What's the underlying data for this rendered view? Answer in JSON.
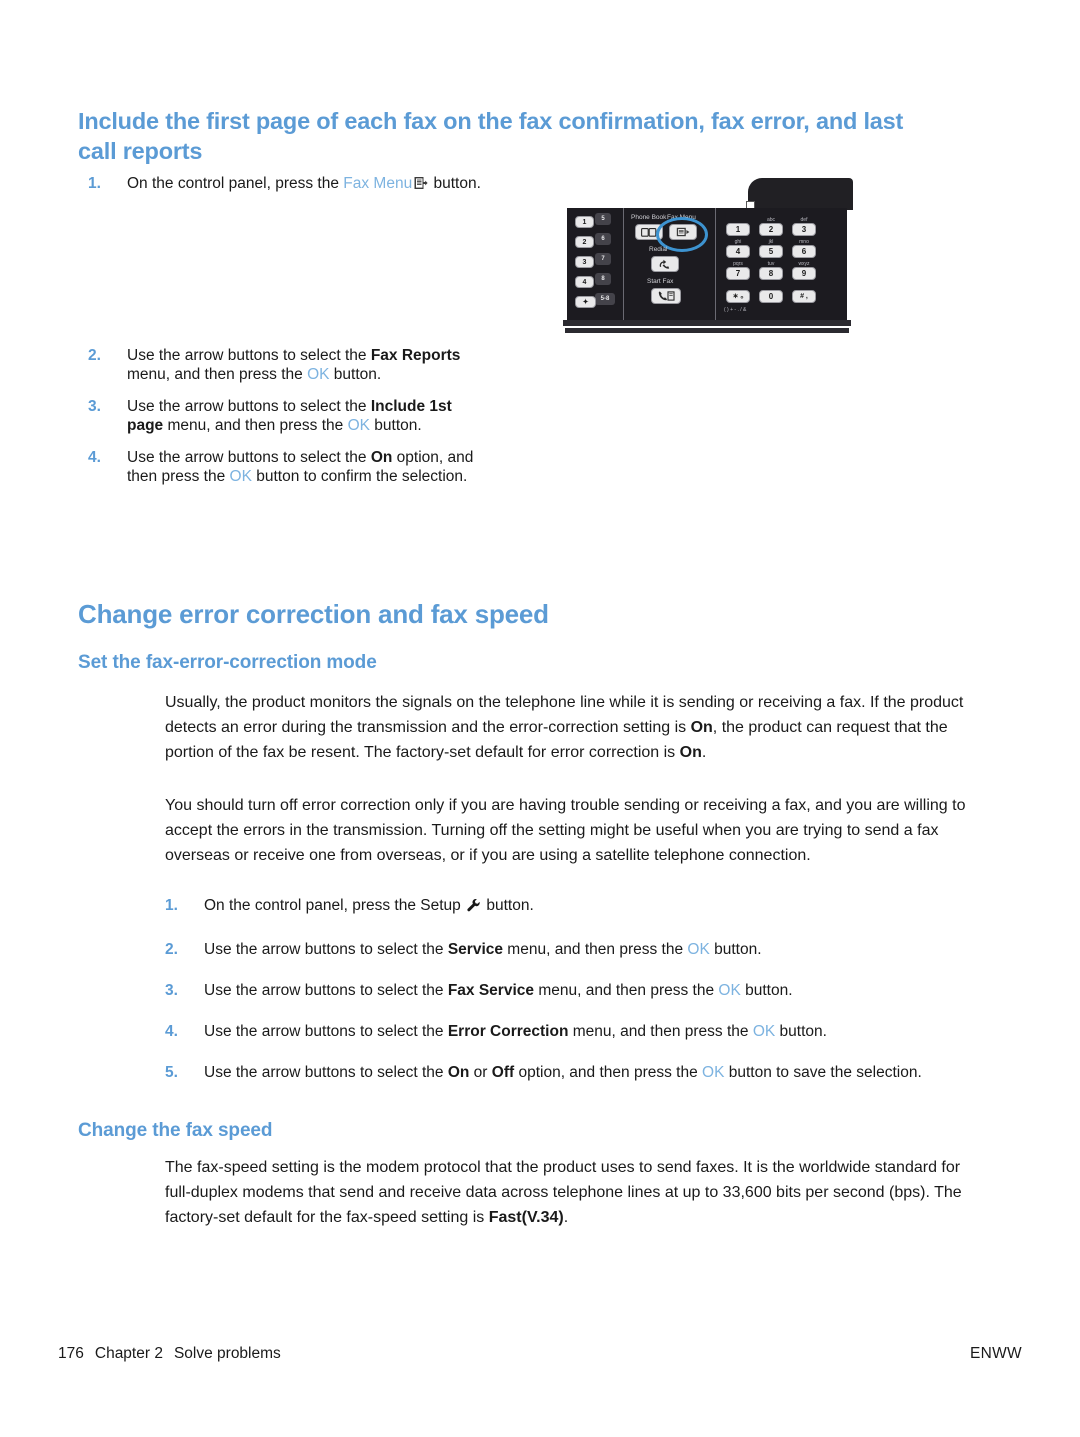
{
  "document": {
    "heading1": "Include the first page of each fax on the fax confirmation, fax error, and last call reports",
    "heading2": "Change error correction and fax speed",
    "heading3_a": "Set the fax-error-correction mode",
    "heading3_b": "Change the fax speed",
    "heading_color": "#5b9bd5"
  },
  "steps_group1": [
    {
      "num": "1.",
      "prefix": "On the control panel, press the ",
      "link": "Fax Menu",
      "icon": "fax-menu-icon",
      "suffix": " button."
    },
    {
      "num": "2.",
      "prefix": "Use the arrow buttons to select the ",
      "bold1": "Fax Reports",
      "mid": " menu, and then press the ",
      "link": "OK",
      "suffix": " button."
    },
    {
      "num": "3.",
      "prefix": "Use the arrow buttons to select the ",
      "bold1": "Include 1st page",
      "mid": " menu, and then press the ",
      "link": "OK",
      "suffix": " button."
    },
    {
      "num": "4.",
      "prefix": "Use the arrow buttons to select the ",
      "bold1": "On",
      "mid": " option, and then press the ",
      "link": "OK",
      "suffix": " button to confirm the selection."
    }
  ],
  "paragraphs": {
    "p1_part1": "Usually, the product monitors the signals on the telephone line while it is sending or receiving a fax. If the product detects an error during the transmission and the error-correction setting is ",
    "p1_bold1": "On",
    "p1_part2": ", the product can request that the portion of the fax be resent. The factory-set default for error correction is ",
    "p1_bold2": "On",
    "p1_part3": ".",
    "p2": "You should turn off error correction only if you are having trouble sending or receiving a fax, and you are willing to accept the errors in the transmission. Turning off the setting might be useful when you are trying to send a fax overseas or receive one from overseas, or if you are using a satellite telephone connection.",
    "p3_part1": "The fax-speed setting is the modem protocol that the product uses to send faxes. It is the worldwide standard for full-duplex modems that send and receive data across telephone lines at up to 33,600 bits per second (bps). The factory-set default for the fax-speed setting is ",
    "p3_bold1": "Fast(V.34)",
    "p3_part2": "."
  },
  "steps_group2": [
    {
      "num": "1.",
      "prefix": "On the control panel, press the Setup ",
      "icon": "wrench-icon",
      "suffix": " button."
    },
    {
      "num": "2.",
      "prefix": "Use the arrow buttons to select the ",
      "bold1": "Service",
      "mid": " menu, and then press the ",
      "link": "OK",
      "suffix": " button."
    },
    {
      "num": "3.",
      "prefix": "Use the arrow buttons to select the ",
      "bold1": "Fax Service",
      "mid": " menu, and then press the ",
      "link": "OK",
      "suffix": " button."
    },
    {
      "num": "4.",
      "prefix": "Use the arrow buttons to select the ",
      "bold1": "Error Correction",
      "mid": " menu, and then press the ",
      "link": "OK",
      "suffix": " button."
    },
    {
      "num": "5.",
      "prefix": "Use the arrow buttons to select the ",
      "bold1": "On",
      "mid1": " or ",
      "bold2": "Off",
      "mid": " option, and then press the ",
      "link": "OK",
      "suffix": " button to save the selection."
    }
  ],
  "control_panel": {
    "labels": {
      "phone_book": "Phone Book",
      "fax_menu": "Fax Menu",
      "redial": "Redial",
      "start_fax": "Start Fax"
    },
    "speed_dial_keys": [
      {
        "main": "1",
        "alt": "5"
      },
      {
        "main": "2",
        "alt": "6"
      },
      {
        "main": "3",
        "alt": "7"
      },
      {
        "main": "4",
        "alt": "8"
      },
      {
        "main": "✦",
        "alt": "5-8"
      }
    ],
    "keypad": [
      {
        "digit": "1",
        "letters": ""
      },
      {
        "digit": "2",
        "letters": "abc"
      },
      {
        "digit": "3",
        "letters": "def"
      },
      {
        "digit": "4",
        "letters": "ghi"
      },
      {
        "digit": "5",
        "letters": "jkl"
      },
      {
        "digit": "6",
        "letters": "mno"
      },
      {
        "digit": "7",
        "letters": "pqrs"
      },
      {
        "digit": "8",
        "letters": "tuv"
      },
      {
        "digit": "9",
        "letters": "wxyz"
      },
      {
        "digit": "∗ ₒ",
        "letters": ""
      },
      {
        "digit": "0",
        "letters": ""
      },
      {
        "digit": "# ,",
        "letters": ""
      }
    ],
    "symbol_row": "( ) + - . / &",
    "highlight_color": "#3d93d0"
  },
  "footer": {
    "page_number": "176",
    "chapter": "Chapter 2",
    "chapter_title": "Solve problems",
    "right": "ENWW"
  }
}
